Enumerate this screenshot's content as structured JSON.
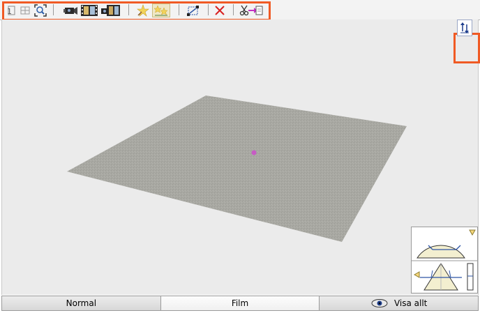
{
  "toolbar": {
    "buttons": [
      {
        "name": "zoom-selection-icon"
      },
      {
        "name": "zoom-window-icon"
      },
      {
        "name": "zoom-extents-icon"
      },
      {
        "name": "camera-icon"
      },
      {
        "name": "film-strip-icon"
      },
      {
        "name": "camera-film-icon"
      },
      {
        "name": "sun-light-icon"
      },
      {
        "name": "lights-toggle-icon"
      },
      {
        "name": "transform-points-icon"
      },
      {
        "name": "delete-icon"
      },
      {
        "name": "cut-paste-icon"
      }
    ]
  },
  "side": {
    "toggle_icon": "vertical-arrows-icon"
  },
  "tabs": [
    {
      "label": "Normal"
    },
    {
      "label": "Film"
    },
    {
      "label": "Visa allt"
    }
  ],
  "colors": {
    "highlight": "#f05a24",
    "viewport_bg": "#ebebeb",
    "ground_plane": "#a9a9a3",
    "focus_point": "#c75bc4"
  }
}
